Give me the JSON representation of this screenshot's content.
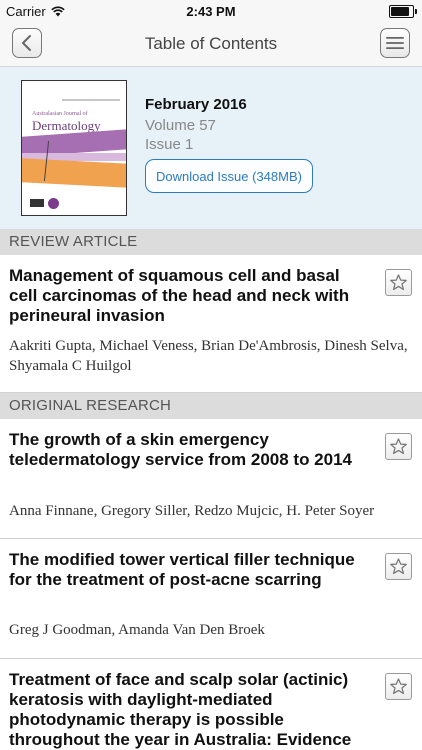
{
  "status_bar": {
    "carrier": "Carrier",
    "time": "2:43 PM",
    "battery_level": 0.95
  },
  "nav": {
    "title": "Table of Contents",
    "back_icon": "chevron-left-icon",
    "menu_icon": "hamburger-menu-icon"
  },
  "issue": {
    "date": "February 2016",
    "volume": "Volume 57",
    "number": "Issue 1",
    "download_label": "Download Issue (348MB)",
    "cover_title": "Dermatology",
    "cover_subtitle": "Australasian Journal of",
    "accent_color": "#2e7cc0"
  },
  "sections": [
    {
      "label": "REVIEW ARTICLE",
      "articles": [
        {
          "title": "Management of squamous cell and basal cell carcinomas of the head and neck with perineural invasion",
          "authors": "Aakriti Gupta, Michael Veness, Brian De'Ambrosis, Dinesh Selva, Shyamala C Huilgol"
        }
      ]
    },
    {
      "label": "ORIGINAL RESEARCH",
      "articles": [
        {
          "title": "The growth of a skin emergency teledermatology service from 2008 to 2014",
          "authors": "Anna Finnane, Gregory Siller, Redzo Mujcic, H. Peter Soyer"
        },
        {
          "title": "The modified tower vertical filler technique for the treatment of post-acne scarring",
          "authors": "Greg J Goodman, Amanda Van Den Broek"
        },
        {
          "title": "Treatment of face and scalp solar (actinic) keratosis with daylight-mediated photodynamic therapy is possible throughout the year in Australia: Evidence from a clinical",
          "authors": ""
        }
      ]
    }
  ]
}
